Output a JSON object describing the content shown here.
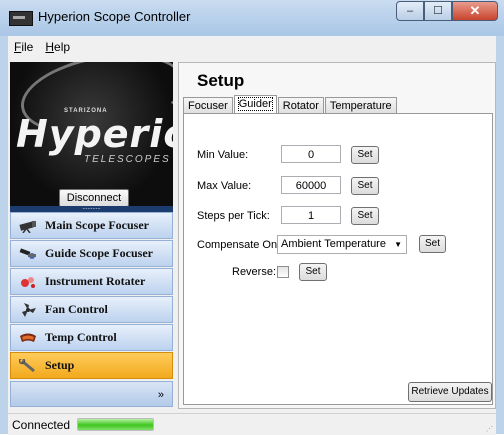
{
  "window": {
    "title": "Hyperion Scope Controller",
    "minimize": "–",
    "maximize": "☐",
    "close": "✕"
  },
  "menu": [
    {
      "key": "F",
      "rest": "ile"
    },
    {
      "key": "H",
      "rest": "elp"
    }
  ],
  "logo": {
    "brand_small": "STARIZONA",
    "brand_big": "Hyperion",
    "brand_sub": "TELESCOPES"
  },
  "sidebar": {
    "disconnect_label": "Disconnect",
    "dots": "...........",
    "items": [
      {
        "label": "Main Scope Focuser",
        "icon": "telescope-icon"
      },
      {
        "label": "Guide Scope Focuser",
        "icon": "guide-scope-icon"
      },
      {
        "label": "Instrument Rotater",
        "icon": "rotator-icon"
      },
      {
        "label": "Fan Control",
        "icon": "fan-icon"
      },
      {
        "label": "Temp Control",
        "icon": "thermometer-icon"
      },
      {
        "label": "Setup",
        "icon": "wrench-icon",
        "active": true
      }
    ],
    "more_label": "»"
  },
  "main": {
    "title": "Setup",
    "tabs": [
      {
        "label": "Focuser"
      },
      {
        "label": "Guider",
        "active": true
      },
      {
        "label": "Rotator"
      },
      {
        "label": "Temperature"
      }
    ],
    "fields": {
      "min_label": "Min Value:",
      "min_value": "0",
      "max_label": "Max Value:",
      "max_value": "60000",
      "steps_label": "Steps per Tick:",
      "steps_value": "1",
      "comp_label": "Compensate On:",
      "comp_value": "Ambient Temperature",
      "reverse_label": "Reverse:"
    },
    "set_label": "Set",
    "retrieve_label": "Retrieve Updates"
  },
  "status": {
    "text": "Connected",
    "progress": 1.0
  },
  "colors": {
    "accent_active": "#f2a91d",
    "nav_bg": "#bcd2ee",
    "progress_fill": "#3fc51e"
  }
}
